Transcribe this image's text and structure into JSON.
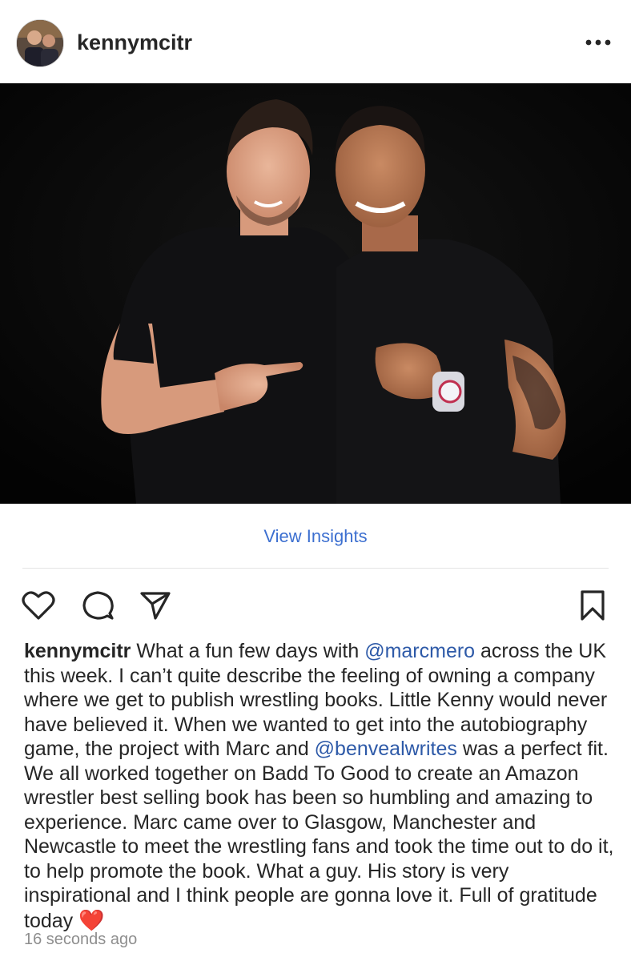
{
  "post": {
    "username": "kennymcitr",
    "more_icon": "more-horizontal-icon",
    "photo_alt": "photo"
  },
  "insights": {
    "label": "View Insights"
  },
  "actions": {
    "like_icon": "heart-outline-icon",
    "comment_icon": "comment-bubble-icon",
    "share_icon": "paper-plane-icon",
    "save_icon": "bookmark-icon"
  },
  "caption": {
    "username": "kennymcitr",
    "text_1": " What a fun few days with ",
    "mention_1": "@marcmero",
    "text_2": " across the UK this week. I can’t quite describe the feeling of owning a company where we get to publish wrestling books. Little Kenny would never have believed it. When we wanted to get into the autobiography game, the project with Marc and ",
    "mention_2": "@benvealwrites",
    "text_3": " was a perfect fit. We all worked together on Badd To Good to create an Amazon wrestler best selling book has been so humbling and amazing to experience. Marc came over to Glasgow, Manchester and Newcastle to meet the wrestling fans and took the time out to do it, to help promote the book. What a guy. His story is very inspirational and I think people are gonna love it. Full of gratitude today ",
    "emoji": "❤️"
  },
  "timestamp": "16 seconds ago",
  "colors": {
    "link": "#3c6fd0",
    "mention": "#2e5aa8",
    "text": "#262626",
    "muted": "#8e8e8e"
  }
}
